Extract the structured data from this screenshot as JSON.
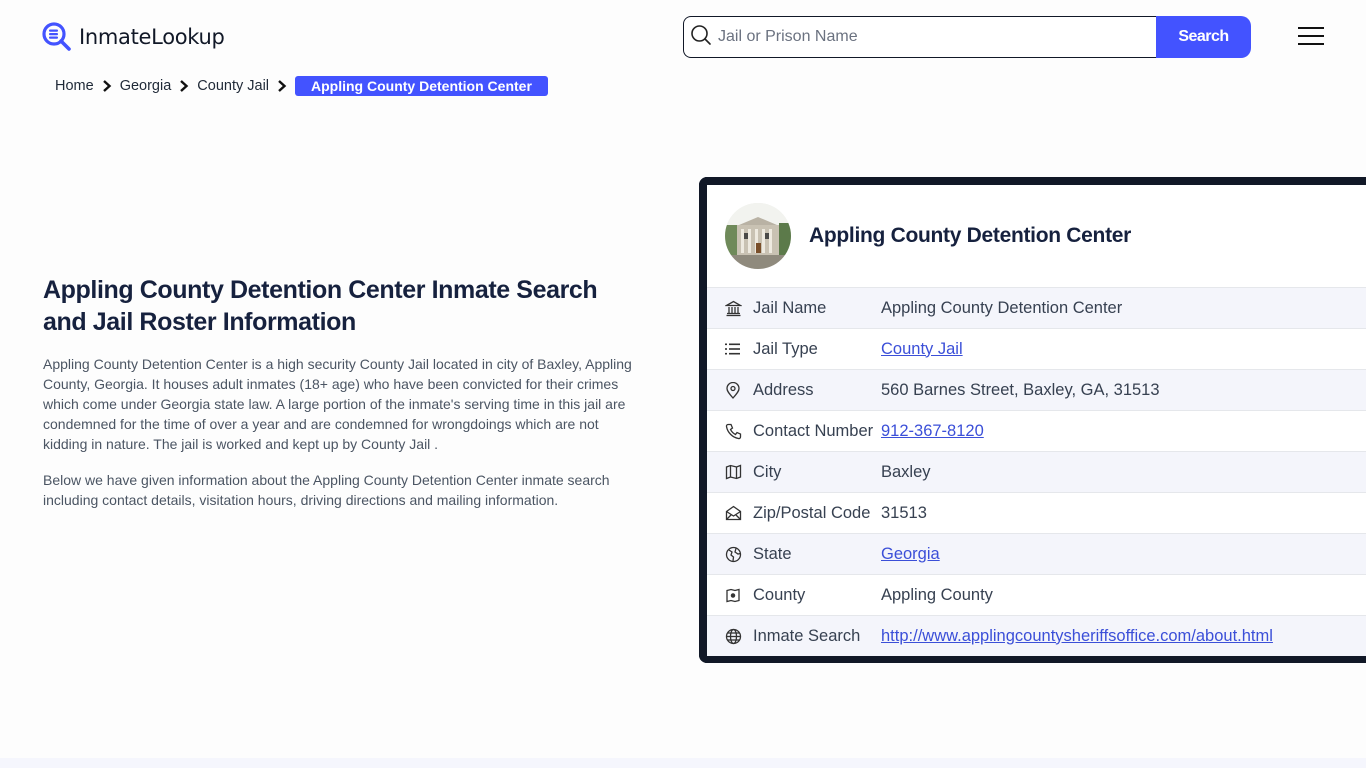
{
  "header": {
    "logo_text": "InmateLookup",
    "search_placeholder": "Jail or Prison Name",
    "search_button": "Search",
    "menu_icon": "hamburger-icon"
  },
  "breadcrumb": {
    "items": [
      "Home",
      "Georgia",
      "County Jail"
    ],
    "current": "Appling County Detention Center"
  },
  "intro": {
    "title": "Appling County Detention Center Inmate Search and Jail Roster Information",
    "paragraphs": [
      "Appling County Detention Center is a high security County Jail located in city of Baxley, Appling County, Georgia. It houses adult inmates (18+ age) who have been convicted for their crimes which come under Georgia state law. A large portion of the inmate's serving time in this jail are condemned for the time of over a year and are condemned for wrongdoings which are not kidding in nature. The jail is worked and kept up by County Jail .",
      "Below we have given information about the Appling County Detention Center inmate search including contact details, visitation hours, driving directions and mailing information."
    ]
  },
  "card": {
    "title": "Appling County Detention Center",
    "rows": [
      {
        "icon": "bank-icon",
        "label": "Jail Name",
        "value": "Appling County Detention Center",
        "link": false
      },
      {
        "icon": "list-icon",
        "label": "Jail Type",
        "value": "County Jail",
        "link": true
      },
      {
        "icon": "map-pin-icon",
        "label": "Address",
        "value": "560 Barnes Street, Baxley, GA, 31513",
        "link": false
      },
      {
        "icon": "phone-icon",
        "label": "Contact Number",
        "value": "912-367-8120",
        "link": true
      },
      {
        "icon": "map-icon",
        "label": "City",
        "value": "Baxley",
        "link": false
      },
      {
        "icon": "mail-open-icon",
        "label": "Zip/Postal Code",
        "value": "31513",
        "link": false
      },
      {
        "icon": "globe-marker-icon",
        "label": "State",
        "value": "Georgia",
        "link": true
      },
      {
        "icon": "county-map-icon",
        "label": "County",
        "value": "Appling County",
        "link": false
      },
      {
        "icon": "world-icon",
        "label": "Inmate Search",
        "value": "http://www.applingcountysheriffsoffice.com/about.html",
        "link": true
      }
    ]
  },
  "colors": {
    "accent": "#4353ff",
    "card_border": "#111827",
    "link": "#3b4fd8",
    "row_alt": "#f4f5fb"
  }
}
